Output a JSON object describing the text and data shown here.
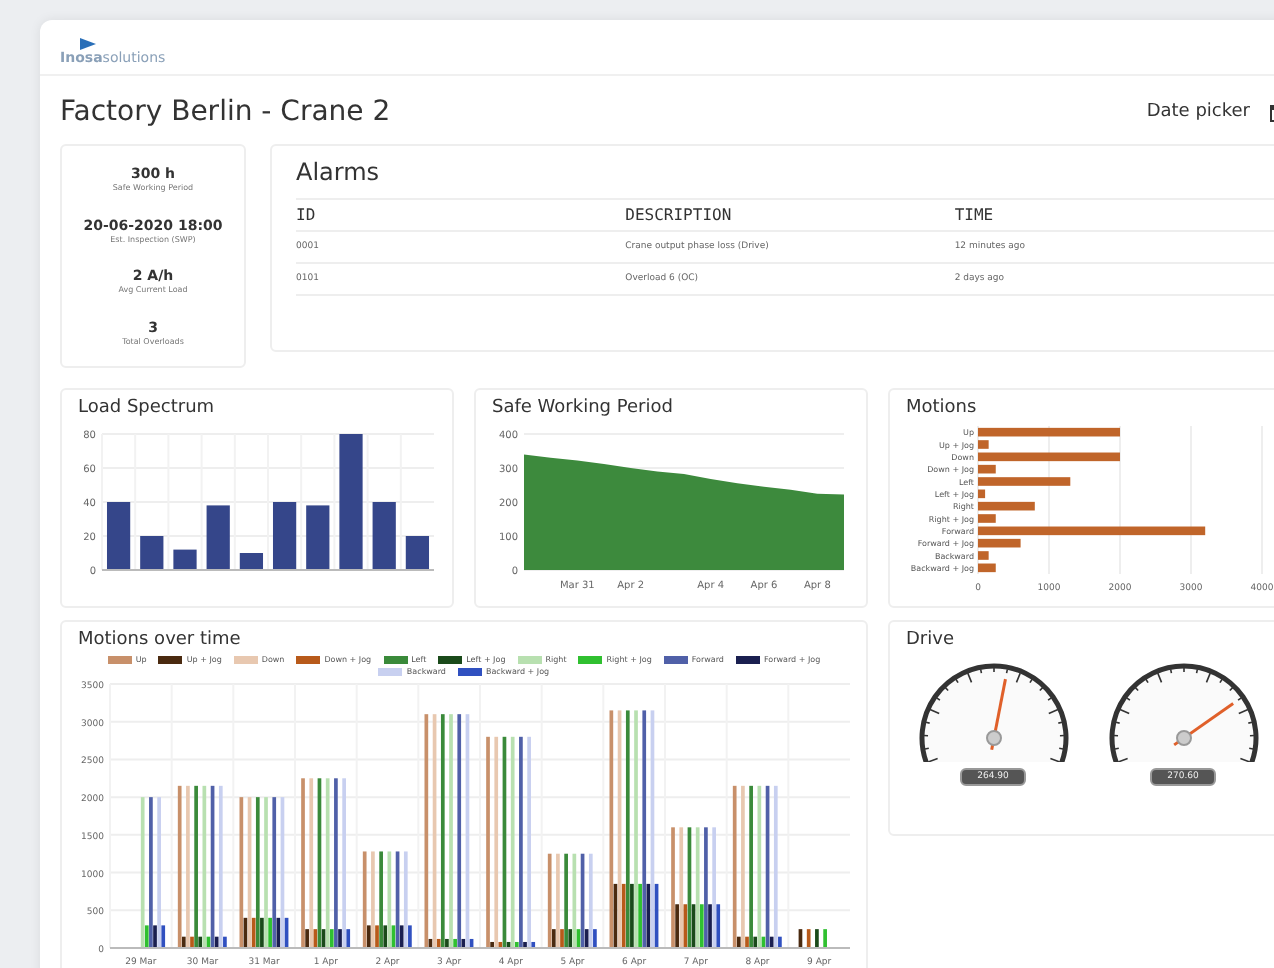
{
  "header": {
    "logo": "**Inosa**solutions"
  },
  "page": {
    "title": "Factory Berlin - Crane 2",
    "date_picker": "Date picker"
  },
  "stats": [
    {
      "value": "300 h",
      "label": "Safe Working Period"
    },
    {
      "value": "20-06-2020 18:00",
      "label": "Est. Inspection (SWP)"
    },
    {
      "value": "2  A/h",
      "label": "Avg Current Load"
    },
    {
      "value": "3",
      "label": "Total Overloads"
    }
  ],
  "alarms": {
    "title": "Alarms",
    "columns": [
      "ID",
      "DESCRIPTION",
      "TIME"
    ],
    "rows": [
      [
        "0001",
        "Crane output phase loss (Drive)",
        "12 minutes ago"
      ],
      [
        "0101",
        "Overload 6 (OC)",
        "2 days ago"
      ]
    ]
  },
  "load_spectrum": {
    "title": "Load Spectrum",
    "chart_data": {
      "type": "bar",
      "grid": true,
      "series": [
        {
          "color": "#35468a",
          "values": [
            40,
            20,
            12,
            38,
            10,
            40,
            38,
            80,
            40,
            20
          ]
        }
      ],
      "ylim": [
        0,
        80
      ],
      "yticks": [
        0,
        20,
        40,
        60,
        80
      ]
    }
  },
  "safe_working_period": {
    "title": "Safe Working Period",
    "chart_data": {
      "type": "area",
      "grid": true,
      "categories": [
        null,
        null,
        "Mar 31",
        null,
        "Apr 2",
        null,
        null,
        "Apr 4",
        null,
        "Apr 6",
        null,
        "Apr 8",
        null
      ],
      "series": [
        {
          "color": "#3d8a3d",
          "values": [
            340,
            330,
            322,
            312,
            300,
            290,
            282,
            268,
            255,
            245,
            236,
            224,
            222
          ]
        }
      ],
      "ylim": [
        0,
        400
      ],
      "yticks": [
        0,
        100,
        200,
        300,
        400
      ]
    }
  },
  "motions": {
    "title": "Motions",
    "chart_data": {
      "type": "bar",
      "grid": true,
      "orientation": "horizontal",
      "categories": [
        "Up",
        "Up + Jog",
        "Down",
        "Down + Jog",
        "Left",
        "Left + Jog",
        "Right",
        "Right + Jog",
        "Forward",
        "Forward + Jog",
        "Backward",
        "Backward + Jog"
      ],
      "series": [
        {
          "color": "#c0652a",
          "values": [
            2000,
            150,
            2000,
            250,
            1300,
            100,
            800,
            250,
            3200,
            600,
            150,
            250
          ]
        }
      ],
      "xlim": [
        0,
        4000
      ],
      "xticks": [
        0,
        1000,
        2000,
        3000,
        4000
      ]
    }
  },
  "motions_over_time": {
    "title": "Motions over time",
    "chart_data": {
      "type": "bar",
      "grid": true,
      "categories": [
        "29 Mar",
        "30 Mar",
        "31 Mar",
        "1 Apr",
        "2 Apr",
        "3 Apr",
        "4 Apr",
        "5 Apr",
        "6 Apr",
        "7 Apr",
        "8 Apr",
        "9 Apr"
      ],
      "ylim": [
        0,
        3500
      ],
      "yticks": [
        0,
        500,
        1000,
        1500,
        2000,
        2500,
        3000,
        3500
      ],
      "series": [
        {
          "name": "Up",
          "color": "#c8906a",
          "values": [
            null,
            2150,
            2000,
            2250,
            1280,
            3100,
            2800,
            1250,
            3150,
            1600,
            2150,
            null
          ]
        },
        {
          "name": "Up + Jog",
          "color": "#4a2a10",
          "values": [
            null,
            150,
            400,
            250,
            300,
            120,
            80,
            250,
            850,
            580,
            150,
            250
          ]
        },
        {
          "name": "Down",
          "color": "#e8c8b0",
          "values": [
            null,
            2150,
            2000,
            2250,
            1280,
            3100,
            2800,
            1250,
            3150,
            1600,
            2150,
            null
          ]
        },
        {
          "name": "Down + Jog",
          "color": "#b85a1a",
          "values": [
            null,
            150,
            400,
            250,
            300,
            120,
            80,
            250,
            850,
            580,
            150,
            250
          ]
        },
        {
          "name": "Left",
          "color": "#3a8a3a",
          "values": [
            null,
            2150,
            2000,
            2250,
            1280,
            3100,
            2800,
            1250,
            3150,
            1600,
            2150,
            null
          ]
        },
        {
          "name": "Left + Jog",
          "color": "#1a4a1a",
          "values": [
            null,
            150,
            400,
            250,
            300,
            120,
            80,
            250,
            850,
            580,
            150,
            250
          ]
        },
        {
          "name": "Right",
          "color": "#b8e0b0",
          "values": [
            2000,
            2150,
            2000,
            2250,
            1280,
            3100,
            2800,
            1250,
            3150,
            1600,
            2150,
            null
          ]
        },
        {
          "name": "Right + Jog",
          "color": "#30c030",
          "values": [
            300,
            150,
            400,
            250,
            300,
            120,
            80,
            250,
            850,
            580,
            150,
            250
          ]
        },
        {
          "name": "Forward",
          "color": "#5060a8",
          "values": [
            2000,
            2150,
            2000,
            2250,
            1280,
            3100,
            2800,
            1250,
            3150,
            1600,
            2150,
            null
          ]
        },
        {
          "name": "Forward + Jog",
          "color": "#1a1f50",
          "values": [
            300,
            150,
            400,
            250,
            300,
            120,
            80,
            250,
            850,
            580,
            150,
            null
          ]
        },
        {
          "name": "Backward",
          "color": "#c8d0f0",
          "values": [
            2000,
            2150,
            2000,
            2250,
            1280,
            3100,
            2800,
            1250,
            3150,
            1600,
            2150,
            null
          ]
        },
        {
          "name": "Backward + Jog",
          "color": "#3050c0",
          "values": [
            300,
            150,
            400,
            250,
            300,
            120,
            80,
            250,
            850,
            580,
            150,
            null
          ]
        }
      ]
    }
  },
  "drive": {
    "title": "Drive",
    "gauges": [
      {
        "level": 0.55,
        "reading": "264.90"
      },
      {
        "level": 0.75,
        "reading": "270.60"
      }
    ]
  }
}
